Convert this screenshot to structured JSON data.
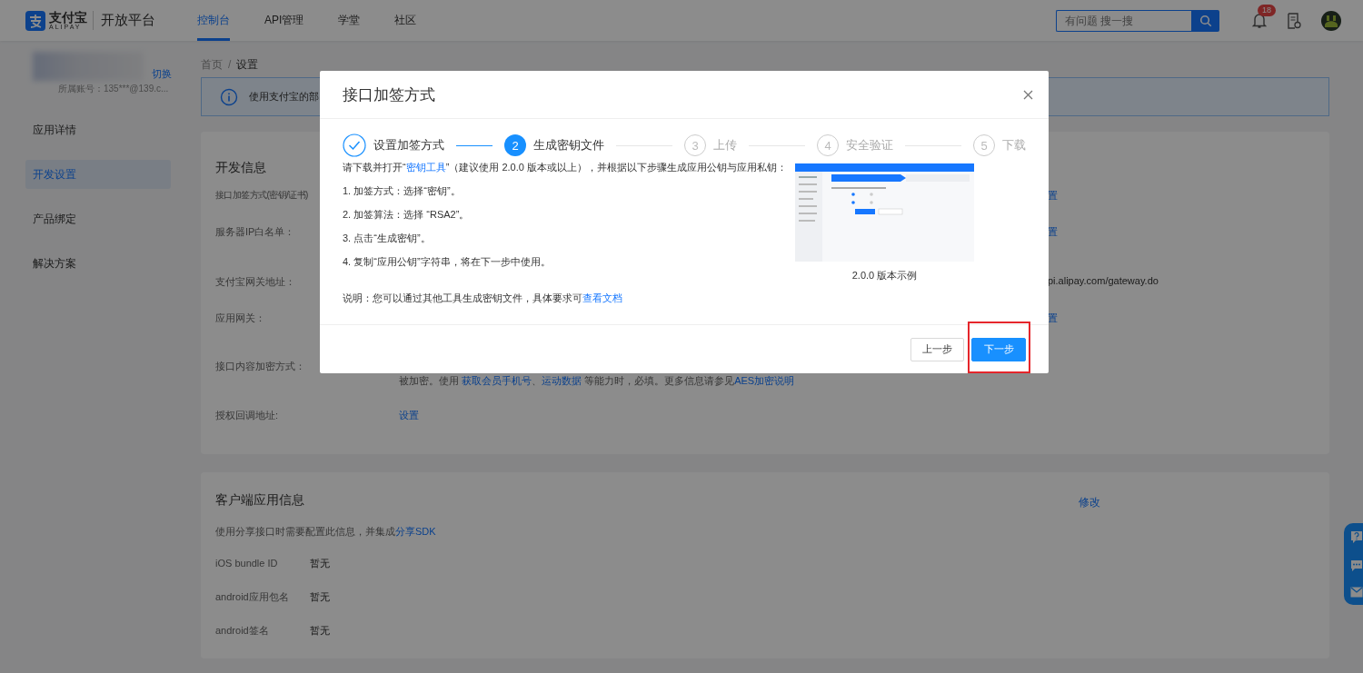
{
  "header": {
    "logo": {
      "brand": "支付宝",
      "brand_en": "ALIPAY",
      "product": "开放平台"
    },
    "nav": [
      {
        "label": "控制台",
        "selected": true
      },
      {
        "label": "API管理",
        "selected": false
      },
      {
        "label": "学堂",
        "selected": false
      },
      {
        "label": "社区",
        "selected": false
      }
    ],
    "search": {
      "placeholder": "有问题 搜一搜"
    },
    "notifications": {
      "badge": "18"
    }
  },
  "sidebar": {
    "switch_link": "切换",
    "account": "所属账号：135***@139.c...",
    "items": [
      {
        "label": "应用详情",
        "selected": false
      },
      {
        "label": "开发设置",
        "selected": true
      },
      {
        "label": "产品绑定",
        "selected": false
      },
      {
        "label": "解决方案",
        "selected": false
      }
    ]
  },
  "breadcrumb": {
    "items": [
      "首页",
      "设置"
    ],
    "separator": "/"
  },
  "alert": {
    "text": "使用支付宝的部"
  },
  "dev_card": {
    "title": "开发信息",
    "rows": [
      {
        "label": "接口加签方式(密钥/证书)",
        "tail": {
          "text": "置",
          "kind": "link"
        }
      },
      {
        "label": "服务器IP白名单：",
        "tail": {
          "text": "置",
          "kind": "link"
        }
      },
      {
        "label": "支付宝网关地址：",
        "tail": {
          "text": "pi.alipay.com/gateway.do",
          "kind": "text"
        }
      },
      {
        "label": "应用网关：",
        "tail": {
          "text": "置",
          "kind": "link"
        }
      },
      {
        "label": "接口内容加密方式：",
        "note": [
          {
            "text": "被加密。使用 "
          },
          {
            "text": "获取会员手机号",
            "link": true
          },
          {
            "text": "、"
          },
          {
            "text": "运动数据",
            "link": true
          },
          {
            "text": " 等能力时，必填。更多信息请参见"
          },
          {
            "text": "AES加密说明",
            "link": true
          }
        ]
      },
      {
        "label": "授权回调地址:",
        "value": {
          "text": "设置",
          "kind": "link"
        }
      }
    ]
  },
  "client_card": {
    "title": "客户端应用信息",
    "edit_link": "修改",
    "description": [
      {
        "text": "使用分享接口时需要配置此信息，并集成"
      },
      {
        "text": "分享SDK",
        "link": true
      }
    ],
    "fields": [
      {
        "label": "iOS bundle ID",
        "value": "暂无"
      },
      {
        "label": "android应用包名",
        "value": "暂无"
      },
      {
        "label": "android签名",
        "value": "暂无"
      }
    ]
  },
  "modal": {
    "title": "接口加签方式",
    "steps": [
      {
        "label": "设置加签方式",
        "done": true,
        "selected": false
      },
      {
        "number": "2",
        "label": "生成密钥文件",
        "done": false,
        "selected": true
      },
      {
        "number": "3",
        "label": "上传",
        "done": false,
        "selected": false
      },
      {
        "number": "4",
        "label": "安全验证",
        "done": false,
        "selected": false
      },
      {
        "number": "5",
        "label": "下载",
        "done": false,
        "selected": false
      }
    ],
    "intro": [
      {
        "text": "请下载并打开“"
      },
      {
        "text": "密钥工具",
        "link": true
      },
      {
        "text": "”（建议使用 2.0.0 版本或以上），并根据以下步骤生成应用公钥与应用私钥："
      }
    ],
    "instructions": [
      "1. 加签方式：选择“密钥”。",
      "2. 加签算法：选择 “RSA2”。",
      "3. 点击“生成密钥”。",
      "4. 复制“应用公钥”字符串，将在下一步中使用。"
    ],
    "note": [
      {
        "text": "说明：您可以通过其他工具生成密钥文件，具体要求可"
      },
      {
        "text": "查看文档",
        "link": true
      }
    ],
    "example_caption": "2.0.0 版本示例",
    "buttons": [
      {
        "label": "上一步",
        "kind": "secondary",
        "highlighted": false
      },
      {
        "label": "下一步",
        "kind": "primary",
        "highlighted": true
      }
    ]
  }
}
